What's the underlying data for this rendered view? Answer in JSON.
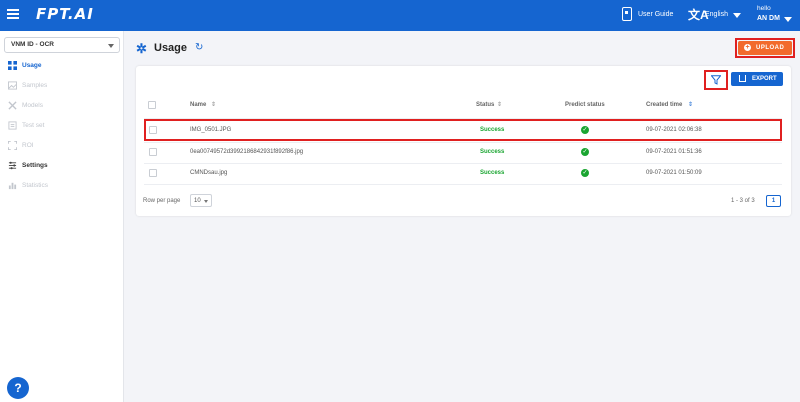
{
  "topbar": {
    "logo": "FPT.AI",
    "user_guide": "User Guide",
    "language": "English",
    "greeting": "hello",
    "user_name": "AN DM",
    "icons": [
      "menu-icon",
      "book-icon",
      "translate-icon",
      "chevron-down-icon"
    ]
  },
  "sidebar": {
    "project": "VNM ID - OCR",
    "items": [
      {
        "label": "Usage",
        "icon": "grid-icon",
        "state": "active"
      },
      {
        "label": "Samples",
        "icon": "image-icon",
        "state": "disabled"
      },
      {
        "label": "Models",
        "icon": "model-icon",
        "state": "disabled"
      },
      {
        "label": "Test set",
        "icon": "testset-icon",
        "state": "disabled"
      },
      {
        "label": "ROI",
        "icon": "roi-icon",
        "state": "disabled"
      },
      {
        "label": "Settings",
        "icon": "gear-icon",
        "state": "normal"
      },
      {
        "label": "Statistics",
        "icon": "chart-icon",
        "state": "disabled"
      }
    ],
    "help_label": "?"
  },
  "main": {
    "title": "Usage",
    "upload_label": "UPLOAD",
    "export_label": "EXPORT",
    "columns": {
      "name": "Name",
      "status": "Status",
      "predict_status": "Predict status",
      "created_time": "Created time"
    },
    "rows": [
      {
        "name": "IMG_0501.JPG",
        "status": "Success",
        "created": "09-07-2021 02:06:38"
      },
      {
        "name": "0ea00749572d3992186842931f892f86.jpg",
        "status": "Success",
        "created": "09-07-2021 01:51:36"
      },
      {
        "name": "CMNDsau.jpg",
        "status": "Success",
        "created": "09-07-2021 01:50:09"
      }
    ],
    "pagination": {
      "rows_per_page_label": "Row per page",
      "rows_per_page": "10",
      "range": "1 - 3 of 3",
      "page": "1"
    }
  },
  "colors": {
    "primary": "#1565d0",
    "upload": "#f26a2c",
    "success": "#1aa531",
    "highlight": "#e02020"
  }
}
